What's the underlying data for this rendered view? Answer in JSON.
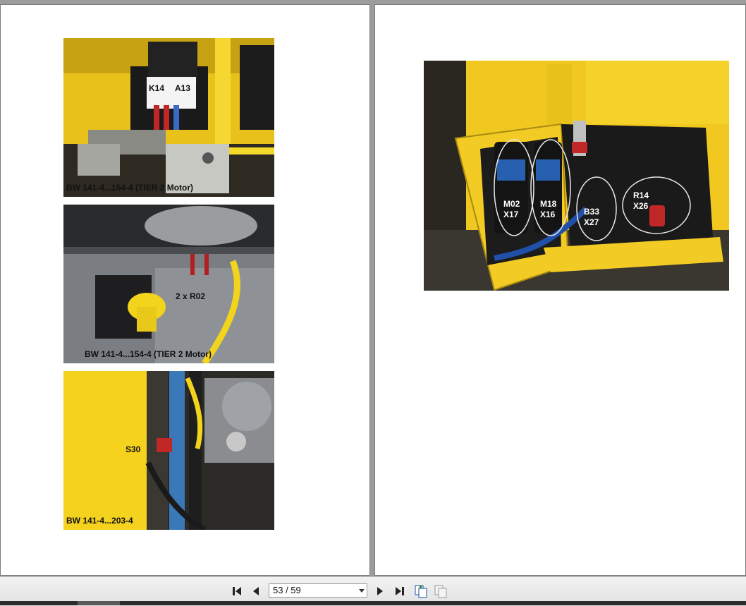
{
  "viewer": {
    "page_indicator": "53 / 59"
  },
  "left_page": {
    "photo1": {
      "labels": [
        "K14",
        "A13"
      ],
      "caption": "BW 141-4...154-4 (TIER 2 Motor)"
    },
    "photo2": {
      "labels": [
        "2 x R02"
      ],
      "caption": "BW 141-4...154-4 (TIER 2 Motor)"
    },
    "photo3": {
      "labels": [
        "S30"
      ],
      "caption": "BW 141-4...203-4"
    }
  },
  "right_page": {
    "photo4": {
      "labels": [
        {
          "line1": "M02",
          "line2": "X17"
        },
        {
          "line1": "M18",
          "line2": "X16"
        },
        {
          "line1": "B33",
          "line2": "X27"
        },
        {
          "line1": "R14",
          "line2": "X26"
        }
      ]
    }
  },
  "colors": {
    "machine_yellow": "#f2c81c",
    "background_gray": "#9c9c9c"
  },
  "icons": [
    "first-page-icon",
    "previous-page-icon",
    "next-page-icon",
    "last-page-icon",
    "fit-page-icon",
    "continuous-view-icon"
  ]
}
